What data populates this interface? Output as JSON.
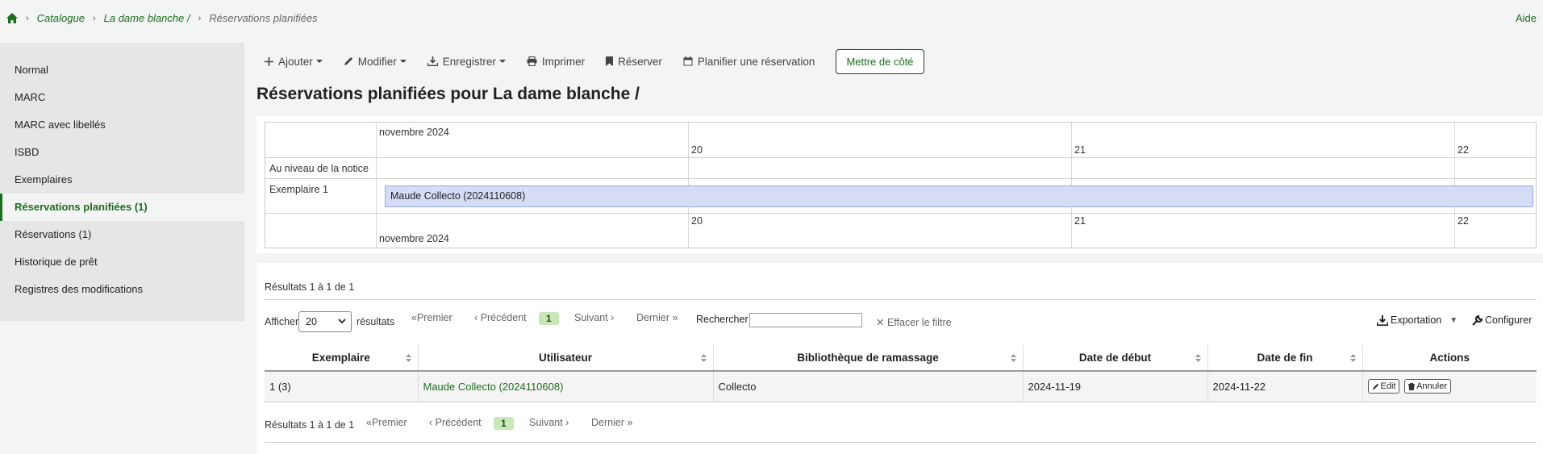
{
  "breadcrumb": {
    "items": [
      "Catalogue",
      "La dame blanche /"
    ],
    "current": "Réservations planifiées"
  },
  "help": "Aide",
  "sidebar": {
    "items": [
      {
        "label": "Normal"
      },
      {
        "label": "MARC"
      },
      {
        "label": "MARC avec libellés"
      },
      {
        "label": "ISBD"
      },
      {
        "label": "Exemplaires"
      },
      {
        "label": "Réservations planifiées (1)",
        "active": true
      },
      {
        "label": "Réservations (1)"
      },
      {
        "label": "Historique de prêt"
      },
      {
        "label": "Registres des modifications"
      }
    ]
  },
  "toolbar": {
    "add": "Ajouter",
    "edit": "Modifier",
    "save": "Enregistrer",
    "print": "Imprimer",
    "reserve": "Réserver",
    "plan": "Planifier une réservation",
    "set_aside": "Mettre de côté"
  },
  "page_title": "Réservations planifiées pour La dame blanche /",
  "timeline": {
    "month": "novembre 2024",
    "days": [
      "20",
      "21",
      "22"
    ],
    "rows": [
      "Au niveau de la notice",
      "Exemplaire 1"
    ],
    "booking_label": "Maude Collecto (2024110608)"
  },
  "results": {
    "summary": "Résultats 1 à 1 de 1",
    "show_label": "Afficher",
    "page_size": "20",
    "results_label": "résultats",
    "search_label": "Rechercher :",
    "clear_filter": "Effacer le filtre",
    "export": "Exportation",
    "configure": "Configurer",
    "pager": {
      "first": "Premier",
      "previous": "Précédent",
      "current": "1",
      "next": "Suivant",
      "last": "Dernier"
    },
    "columns": [
      "Exemplaire",
      "Utilisateur",
      "Bibliothèque de ramassage",
      "Date de début",
      "Date de fin",
      "Actions"
    ],
    "rows": [
      {
        "item": "1 (3)",
        "patron": "Maude Collecto (2024110608)",
        "library": "Collecto",
        "start": "2024-11-19",
        "end": "2024-11-22",
        "edit": "Edit",
        "cancel": "Annuler"
      }
    ]
  },
  "colors": {
    "accent": "#1b6e1b",
    "booking_bar": "#d5ddf6",
    "page_badge": "#c9e8b8"
  }
}
